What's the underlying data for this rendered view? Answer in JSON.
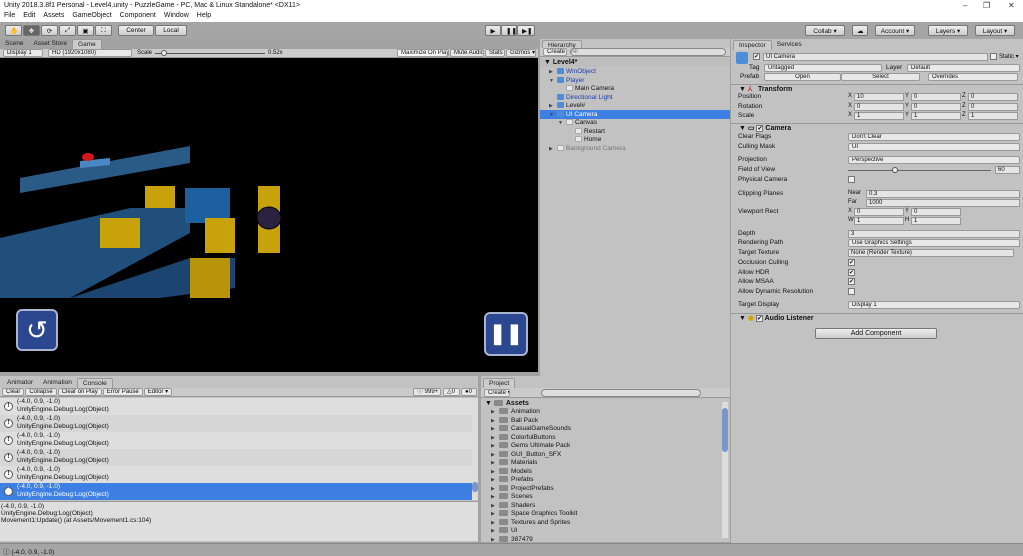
{
  "window": {
    "title": "Unity 2018.3.8f1 Personal - Level4.unity - PuzzleGame - PC, Mac & Linux Standalone* <DX11>",
    "minimize": "–",
    "restore": "❐",
    "close": "✕"
  },
  "menu": [
    "File",
    "Edit",
    "Assets",
    "GameObject",
    "Component",
    "Window",
    "Help"
  ],
  "toolbar": {
    "tools": [
      "✋",
      "✥",
      "⟳",
      "⤢",
      "▣",
      "⛶"
    ],
    "center": "Center",
    "local": "Local",
    "play": "▶",
    "pause": "❚❚",
    "step": "▶❚",
    "collab": "Collab ▾",
    "cloud": "☁",
    "account": "Account ▾",
    "layers": "Layers ▾",
    "layout": "Layout ▾"
  },
  "scene_tabs": [
    "Scene",
    "Asset Store",
    "Game"
  ],
  "game_bar": {
    "display": "Display 1",
    "resolution": "HD (1920x1080)",
    "scale_label": "Scale",
    "scale_value": "0.52x",
    "scale_fraction": 0.05,
    "maximize": "Maximize On Play",
    "mute": "Mute Audio",
    "stats": "Stats",
    "gizmos": "Gizmos ▾"
  },
  "game_view": {
    "restart_icon": "restart-icon",
    "pause_icon": "pause-icon"
  },
  "hierarchy": {
    "tab": "Hierarchy",
    "create": "Create ▾",
    "search_placeholder": "All",
    "scene": "Level4*",
    "items": [
      {
        "label": "WinObject",
        "depth": 1,
        "arrow": "▶",
        "prefab": true
      },
      {
        "label": "Player",
        "depth": 1,
        "arrow": "▼",
        "prefab": true
      },
      {
        "label": "Main Camera",
        "depth": 2,
        "arrow": "",
        "prefab": false,
        "grey": true
      },
      {
        "label": "Directional Light",
        "depth": 1,
        "arrow": "",
        "prefab": true
      },
      {
        "label": "Level#",
        "depth": 1,
        "arrow": "▶",
        "prefab": false
      },
      {
        "label": "UI Camera",
        "depth": 1,
        "arrow": "▼",
        "prefab": false,
        "selected": true
      },
      {
        "label": "Canvas",
        "depth": 2,
        "arrow": "▼",
        "prefab": false,
        "grey": true
      },
      {
        "label": "Restart",
        "depth": 3,
        "arrow": "",
        "prefab": false,
        "grey": true
      },
      {
        "label": "Home",
        "depth": 3,
        "arrow": "",
        "prefab": false,
        "grey": true
      },
      {
        "label": "Background Camera",
        "depth": 1,
        "arrow": "▶",
        "prefab": false,
        "grey": true,
        "disabled": true
      }
    ]
  },
  "inspector": {
    "tabs": [
      "Inspector",
      "Services"
    ],
    "object_name": "UI Camera",
    "static": "Static ▾",
    "tag_label": "Tag",
    "tag": "Untagged",
    "layer_label": "Layer",
    "layer": "Default",
    "prefab_label": "Prefab",
    "open": "Open",
    "select": "Select",
    "overrides": "Overrides",
    "transform": {
      "title": "Transform",
      "rows": [
        {
          "label": "Position",
          "x": "10",
          "y": "0",
          "z": "0"
        },
        {
          "label": "Rotation",
          "x": "0",
          "y": "0",
          "z": "0"
        },
        {
          "label": "Scale",
          "x": "1",
          "y": "1",
          "z": "1"
        }
      ]
    },
    "camera": {
      "title": "Camera",
      "clear_flags_label": "Clear Flags",
      "clear_flags": "Don't Clear",
      "culling_label": "Culling Mask",
      "culling": "UI",
      "projection_label": "Projection",
      "projection": "Perspective",
      "fov_label": "Field of View",
      "fov": "60",
      "fov_fraction": 0.33,
      "physical_label": "Physical Camera",
      "clipping_label": "Clipping Planes",
      "near_label": "Near",
      "near": "0.3",
      "far_label": "Far",
      "far": "1000",
      "viewport_label": "Viewport Rect",
      "vx": "0",
      "vy": "0",
      "vw": "1",
      "vh": "1",
      "depth_label": "Depth",
      "depth": "3",
      "rendering_label": "Rendering Path",
      "rendering": "Use Graphics Settings",
      "target_texture_label": "Target Texture",
      "target_texture": "None (Render Texture)",
      "occlusion_label": "Occlusion Culling",
      "hdr_label": "Allow HDR",
      "msaa_label": "Allow MSAA",
      "dynres_label": "Allow Dynamic Resolution",
      "target_display_label": "Target Display",
      "target_display": "Display 1"
    },
    "audio_listener": "Audio Listener",
    "add_component": "Add Component"
  },
  "console": {
    "tabs": [
      "Animator",
      "Animation",
      "Console"
    ],
    "buttons": [
      "Clear",
      "Collapse",
      "Clear on Play",
      "Error Pause",
      "Editor ▾"
    ],
    "log_count": "999+",
    "warn_count": "0",
    "error_count": "0",
    "entries": [
      {
        "line1": "(-4.0, 0.9, -1.0)",
        "line2": "UnityEngine.Debug:Log(Object)"
      },
      {
        "line1": "(-4.0, 0.9, -1.0)",
        "line2": "UnityEngine.Debug:Log(Object)"
      },
      {
        "line1": "(-4.0, 0.9, -1.0)",
        "line2": "UnityEngine.Debug:Log(Object)"
      },
      {
        "line1": "(-4.0, 0.9, -1.0)",
        "line2": "UnityEngine.Debug:Log(Object)"
      },
      {
        "line1": "(-4.0, 0.9, -1.0)",
        "line2": "UnityEngine.Debug:Log(Object)"
      },
      {
        "line1": "(-4.0, 0.9, -1.0)",
        "line2": "UnityEngine.Debug:Log(Object)",
        "selected": true
      }
    ],
    "detail": [
      "(-4.0, 0.9, -1.0)",
      "UnityEngine.Debug:Log(Object)",
      "Movement1:Update() (at Assets/Movement1.cs:104)"
    ]
  },
  "project": {
    "tab": "Project",
    "create": "Create ▾",
    "root": "Assets",
    "folders": [
      "Animation",
      "Ball Pack",
      "CasualGameSounds",
      "ColorfulButtons",
      "Gems Ultimate Pack",
      "GUI_Button_SFX",
      "Materials",
      "Models",
      "Prefabs",
      "ProjectPrefabs",
      "Scenes",
      "Shaders",
      "Space Graphics Toolkit",
      "Textures and Sprites",
      "UI",
      "387479"
    ]
  },
  "status": {
    "message": "(-4.0, 0.9, -1.0)"
  }
}
